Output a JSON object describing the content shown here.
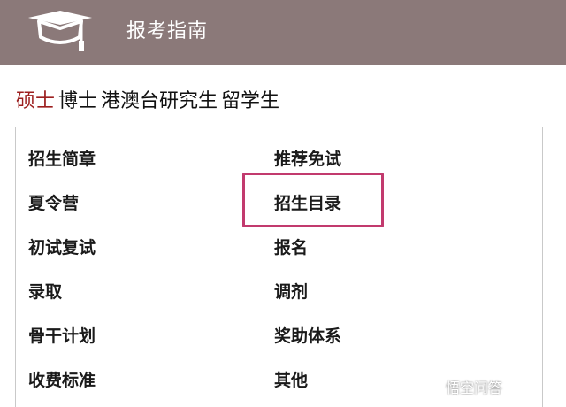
{
  "header": {
    "title": "报考指南",
    "icon": "graduation-cap-icon",
    "background": "#8b7979"
  },
  "tabs": [
    {
      "label": "硕士",
      "active": true
    },
    {
      "label": "博士",
      "active": false
    },
    {
      "label": "港澳台研究生",
      "active": false
    },
    {
      "label": "留学生",
      "active": false
    }
  ],
  "menu": {
    "left": [
      "招生简章",
      "夏令营",
      "初试复试",
      "录取",
      "骨干计划",
      "收费标准"
    ],
    "right": [
      "推荐免试",
      "招生目录",
      "报名",
      "调剂",
      "奖助体系",
      "其他"
    ],
    "highlighted": "招生目录",
    "highlight_color": "#c23a6e"
  },
  "colors": {
    "active_tab": "#9c1f1f"
  },
  "watermark": {
    "text": "悟空问答"
  }
}
